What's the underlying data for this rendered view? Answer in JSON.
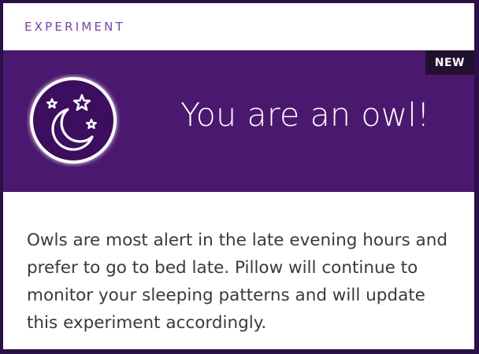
{
  "header": {
    "eyebrow": "EXPERIMENT"
  },
  "banner": {
    "badge": "NEW",
    "title": "You are an owl!",
    "icon": "moon-and-stars-icon"
  },
  "body": {
    "text": "Owls are most alert in the late evening hours and prefer to go to bed late. Pillow will continue to monitor your sleeping patterns and will update this experiment accordingly."
  },
  "colors": {
    "accent": "#7b3fb7",
    "banner": "#4b186f",
    "badge": "#21102f",
    "frame": "#2a0f48"
  }
}
